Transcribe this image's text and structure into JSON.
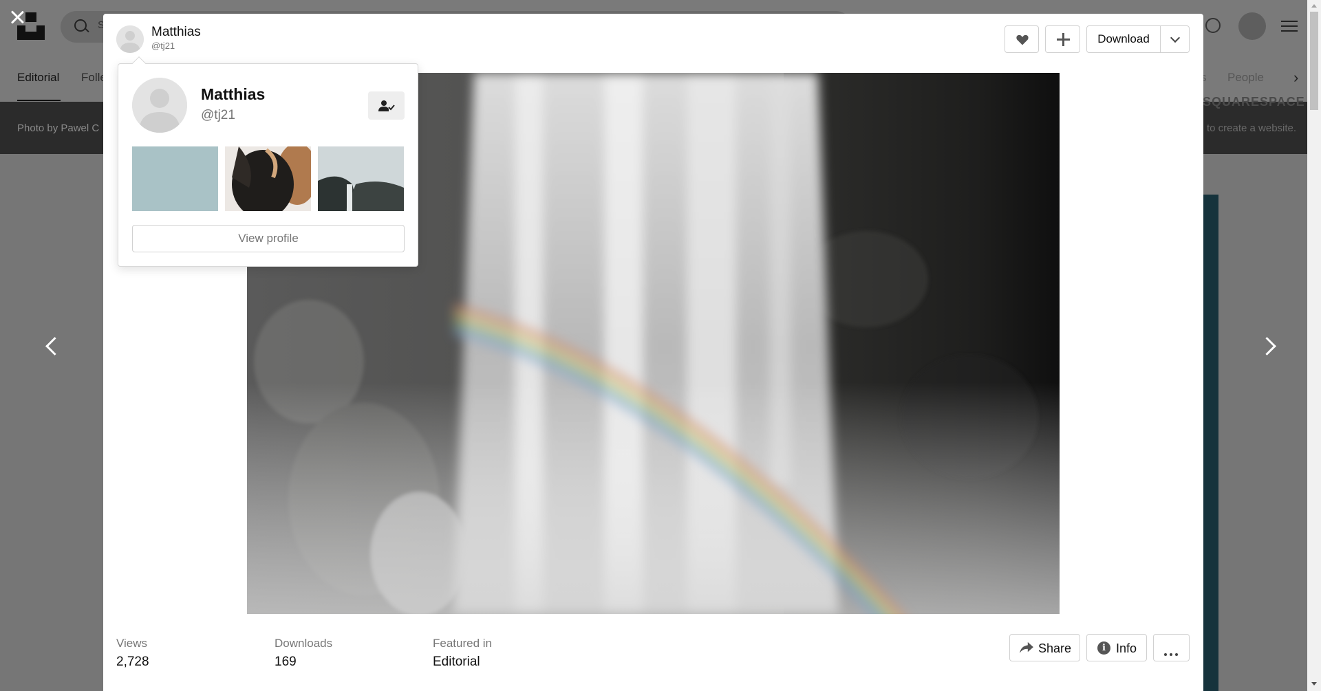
{
  "background": {
    "search_placeholder": "S",
    "tabs": [
      {
        "label": "Editorial"
      },
      {
        "label": "Folle"
      },
      {
        "label": "s"
      },
      {
        "label": "People"
      }
    ],
    "banner": {
      "credit": "Photo by Pawel C",
      "brand": "SQUARESPACE",
      "cta": "to create a website."
    }
  },
  "modal": {
    "author": {
      "name": "Matthias",
      "handle": "@tj21"
    },
    "actions": {
      "download_label": "Download",
      "like_icon": "heart-icon",
      "add_icon": "plus-icon",
      "download_menu_icon": "chevron-down-icon"
    },
    "photo": {
      "subject": "waterfall with rainbow"
    },
    "stats": {
      "views_label": "Views",
      "views_value": "2,728",
      "downloads_label": "Downloads",
      "downloads_value": "169",
      "featured_label": "Featured in",
      "featured_value": "Editorial"
    },
    "footer": {
      "share_label": "Share",
      "info_label": "Info",
      "info_icon_glyph": "i"
    }
  },
  "hover_card": {
    "name": "Matthias",
    "handle": "@tj21",
    "follow_icon": "user-check-icon",
    "view_profile_label": "View profile",
    "thumbnail_colors": [
      "#a9c2c6",
      "#2a2826",
      "#46504f"
    ]
  },
  "colors": {
    "overlay_bg": "#767676",
    "muted_text": "#767676",
    "border": "#d1d1d1"
  }
}
